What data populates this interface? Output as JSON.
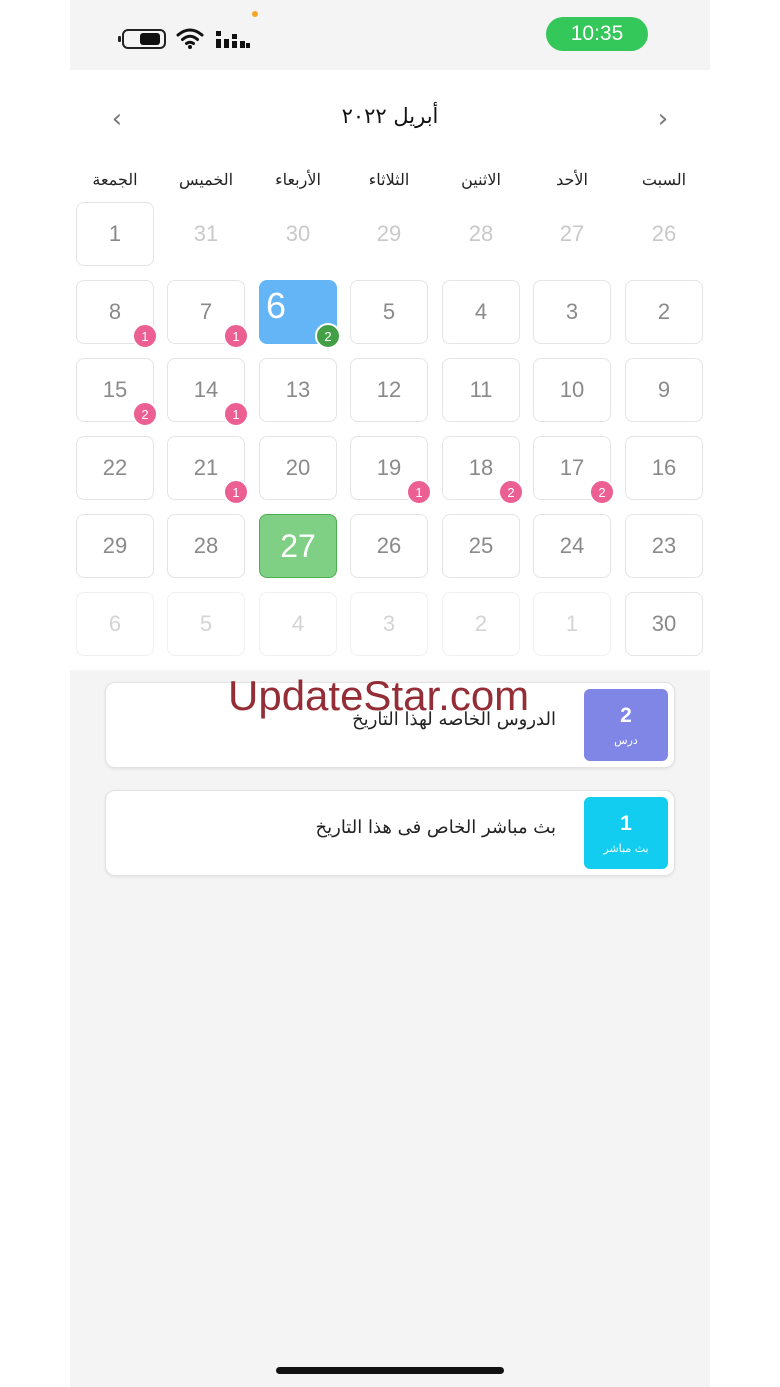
{
  "status_bar": {
    "time": "10:35"
  },
  "calendar": {
    "month_title": "أبريل ٢٠٢٢",
    "prev_arrow": "‹",
    "next_arrow": "›",
    "weekdays": [
      "الجمعة",
      "الخميس",
      "الأربعاء",
      "الثلاثاء",
      "الاثنين",
      "الأحد",
      "السبت"
    ],
    "weeks": [
      [
        {
          "n": "1",
          "state": "normal"
        },
        {
          "n": "31",
          "state": "muted"
        },
        {
          "n": "30",
          "state": "muted"
        },
        {
          "n": "29",
          "state": "muted"
        },
        {
          "n": "28",
          "state": "muted"
        },
        {
          "n": "27",
          "state": "muted"
        },
        {
          "n": "26",
          "state": "muted"
        }
      ],
      [
        {
          "n": "8",
          "state": "normal",
          "badge": "1"
        },
        {
          "n": "7",
          "state": "normal",
          "badge": "1"
        },
        {
          "n": "6",
          "state": "selected",
          "badge": "2",
          "badge_color": "green"
        },
        {
          "n": "5",
          "state": "normal"
        },
        {
          "n": "4",
          "state": "normal"
        },
        {
          "n": "3",
          "state": "normal"
        },
        {
          "n": "2",
          "state": "normal"
        }
      ],
      [
        {
          "n": "15",
          "state": "normal",
          "badge": "2"
        },
        {
          "n": "14",
          "state": "normal",
          "badge": "1"
        },
        {
          "n": "13",
          "state": "normal"
        },
        {
          "n": "12",
          "state": "normal"
        },
        {
          "n": "11",
          "state": "normal"
        },
        {
          "n": "10",
          "state": "normal"
        },
        {
          "n": "9",
          "state": "normal"
        }
      ],
      [
        {
          "n": "22",
          "state": "normal"
        },
        {
          "n": "21",
          "state": "normal",
          "badge": "1"
        },
        {
          "n": "20",
          "state": "normal"
        },
        {
          "n": "19",
          "state": "normal",
          "badge": "1"
        },
        {
          "n": "18",
          "state": "normal",
          "badge": "2"
        },
        {
          "n": "17",
          "state": "normal",
          "badge": "2"
        },
        {
          "n": "16",
          "state": "normal"
        }
      ],
      [
        {
          "n": "29",
          "state": "normal"
        },
        {
          "n": "28",
          "state": "normal"
        },
        {
          "n": "27",
          "state": "today"
        },
        {
          "n": "26",
          "state": "normal"
        },
        {
          "n": "25",
          "state": "normal"
        },
        {
          "n": "24",
          "state": "normal"
        },
        {
          "n": "23",
          "state": "normal"
        }
      ],
      [
        {
          "n": "6",
          "state": "faint"
        },
        {
          "n": "5",
          "state": "faint"
        },
        {
          "n": "4",
          "state": "faint"
        },
        {
          "n": "3",
          "state": "faint"
        },
        {
          "n": "2",
          "state": "faint"
        },
        {
          "n": "1",
          "state": "faint"
        },
        {
          "n": "30",
          "state": "normal"
        }
      ]
    ]
  },
  "cards": [
    {
      "text": "الدروس الخاصه لهذا التاريخ",
      "count": "2",
      "label": "درس",
      "color": "#7f86e6"
    },
    {
      "text": "بث مباشر الخاص فى هذا التاريخ",
      "count": "1",
      "label": "بث مباشر",
      "color": "#12cdf0"
    }
  ],
  "watermark": "UpdateStar.com",
  "colors": {
    "badge_pink": "#ec5f93",
    "badge_green": "#43a047",
    "selected_blue": "#64b5f6",
    "today_green": "#7fcf85",
    "status_green": "#34c759"
  }
}
